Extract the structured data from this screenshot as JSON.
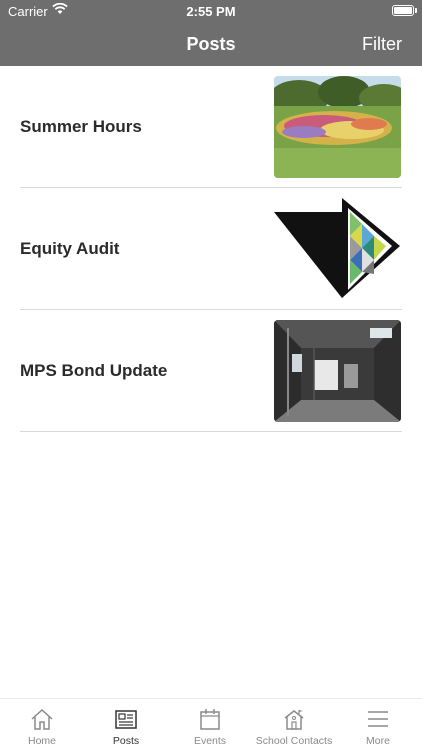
{
  "status_bar": {
    "carrier": "Carrier",
    "time": "2:55 PM"
  },
  "nav": {
    "title": "Posts",
    "filter_label": "Filter"
  },
  "posts": [
    {
      "title": "Summer Hours",
      "image": "group-photo-on-lawn"
    },
    {
      "title": "Equity Audit",
      "image": "black-triangle-mosaic-logo"
    },
    {
      "title": "MPS Bond Update",
      "image": "construction-interior-photo"
    }
  ],
  "tabs": [
    {
      "label": "Home",
      "icon": "home-icon",
      "active": false
    },
    {
      "label": "Posts",
      "icon": "newspaper-icon",
      "active": true
    },
    {
      "label": "Events",
      "icon": "calendar-icon",
      "active": false
    },
    {
      "label": "School Contacts",
      "icon": "school-contacts-icon",
      "active": false
    },
    {
      "label": "More",
      "icon": "menu-icon",
      "active": false
    }
  ],
  "colors": {
    "nav_bg": "#6e6e6e",
    "tab_active": "#333333",
    "tab_inactive": "#8a8a8a"
  }
}
